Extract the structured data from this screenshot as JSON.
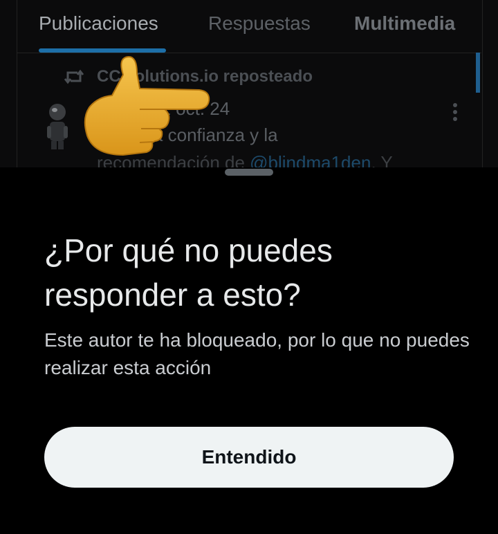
{
  "tabs": [
    {
      "label": "Publicaciones",
      "active": true
    },
    {
      "label": "Respuestas",
      "active": false
    },
    {
      "label": "Multimedia",
      "active": false
    }
  ],
  "post": {
    "repost_label": "CC solutions.io reposteado",
    "meta": "_t_cl · 22 oct. 24",
    "text_line1": "er por la confianza y la",
    "text_line2_prefix": "recomendación de ",
    "text_line2_mention": "@blindma1den",
    "text_line2_suffix": ". Y"
  },
  "sheet": {
    "title": "¿Por qué no puedes responder a esto?",
    "body": "Este autor te ha bloqueado, por lo que no puedes realizar esta acción",
    "button_label": "Entendido"
  },
  "icons": {
    "repost": "repost-icon",
    "more": "more-vertical-icon",
    "pointing": "pointing-hand-emoji"
  },
  "colors": {
    "accent": "#1d9bf0",
    "button_bg": "#eff3f4",
    "background": "#000000"
  }
}
